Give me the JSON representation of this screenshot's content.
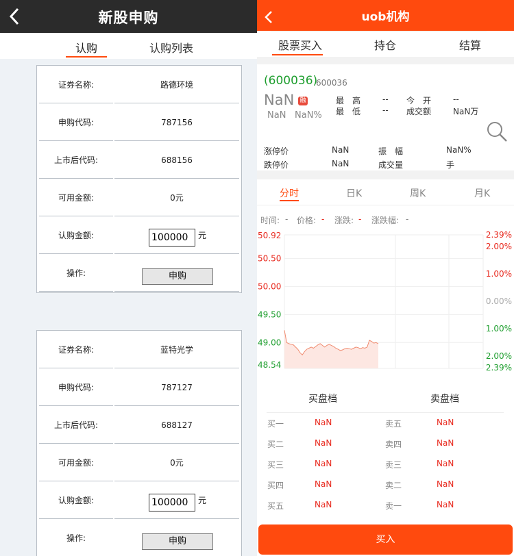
{
  "left": {
    "header": {
      "title": "新股申购"
    },
    "tabs": [
      "认购",
      "认购列表"
    ],
    "card_labels": {
      "name": "证券名称:",
      "sub_code": "申购代码:",
      "list_code": "上市后代码:",
      "available": "可用金额:",
      "amount": "认购金额:",
      "operate": "操作:"
    },
    "unit": "元",
    "button_label": "申购",
    "cards": [
      {
        "name": "路德环境",
        "sub_code": "787156",
        "list_code": "688156",
        "available": "0元",
        "amount": "100000"
      },
      {
        "name": "蓝特光学",
        "sub_code": "787127",
        "list_code": "688127",
        "available": "0元",
        "amount": "100000"
      }
    ]
  },
  "right": {
    "header": {
      "title": "uob机构"
    },
    "tabs": [
      "股票买入",
      "持仓",
      "结算"
    ],
    "quote": {
      "code": "(600036)",
      "code2": "600036",
      "price": "NaN",
      "badge": "融",
      "change": "NaN",
      "change_pct": "NaN%",
      "high_label": "最　高",
      "high": "--",
      "open_label": "今　开",
      "open": "--",
      "low_label": "最　低",
      "low": "--",
      "turnover_label": "成交额",
      "turnover": "NaN万",
      "limit_up_label": "涨停价",
      "limit_up": "NaN",
      "amplitude_label": "振　幅",
      "amplitude": "NaN%",
      "limit_down_label": "跌停价",
      "limit_down": "NaN",
      "volume_label": "成交量",
      "volume": "手"
    },
    "chart_tabs": [
      "分时",
      "日K",
      "周K",
      "月K"
    ],
    "info": {
      "time_label": "时间:",
      "time": "-",
      "price_label": "价格:",
      "price": "-",
      "change_label": "涨跌:",
      "change": "-",
      "pct_label": "涨跌幅:",
      "pct": "-"
    },
    "depth": {
      "buy_title": "买盘档",
      "sell_title": "卖盘档",
      "buy": [
        {
          "label": "买一",
          "value": "NaN"
        },
        {
          "label": "买二",
          "value": "NaN"
        },
        {
          "label": "买三",
          "value": "NaN"
        },
        {
          "label": "买四",
          "value": "NaN"
        },
        {
          "label": "买五",
          "value": "NaN"
        }
      ],
      "sell": [
        {
          "label": "卖五",
          "value": "NaN"
        },
        {
          "label": "卖四",
          "value": "NaN"
        },
        {
          "label": "卖三",
          "value": "NaN"
        },
        {
          "label": "卖二",
          "value": "NaN"
        },
        {
          "label": "卖一",
          "value": "NaN"
        }
      ]
    },
    "buy_button": "买入"
  },
  "colors": {
    "accent": "#ff4a0e",
    "up": "#e8291e",
    "down": "#1e9e2e"
  },
  "chart_data": {
    "type": "line",
    "left_ticks": [
      "50.92",
      "50.50",
      "50.00",
      "49.50",
      "49.00",
      "48.54"
    ],
    "right_ticks": [
      "2.39%",
      "2.00%",
      "1.00%",
      "0.00%",
      "1.00%",
      "2.00%",
      "2.39%"
    ],
    "ylim": [
      48.54,
      50.92
    ],
    "values": [
      49.22,
      49.0,
      48.98,
      48.97,
      48.96,
      48.92,
      48.88,
      48.82,
      48.78,
      48.84,
      48.88,
      48.9,
      48.92,
      48.9,
      48.93,
      48.96,
      48.98,
      48.95,
      48.92,
      48.95,
      48.97,
      48.95,
      48.93,
      48.9,
      48.88,
      48.86,
      48.87,
      48.89,
      48.9,
      48.89,
      48.88,
      48.9,
      48.92,
      48.91,
      48.89,
      48.91,
      48.9,
      48.92,
      49.04,
      49.02,
      48.99,
      49.0,
      48.98
    ]
  }
}
